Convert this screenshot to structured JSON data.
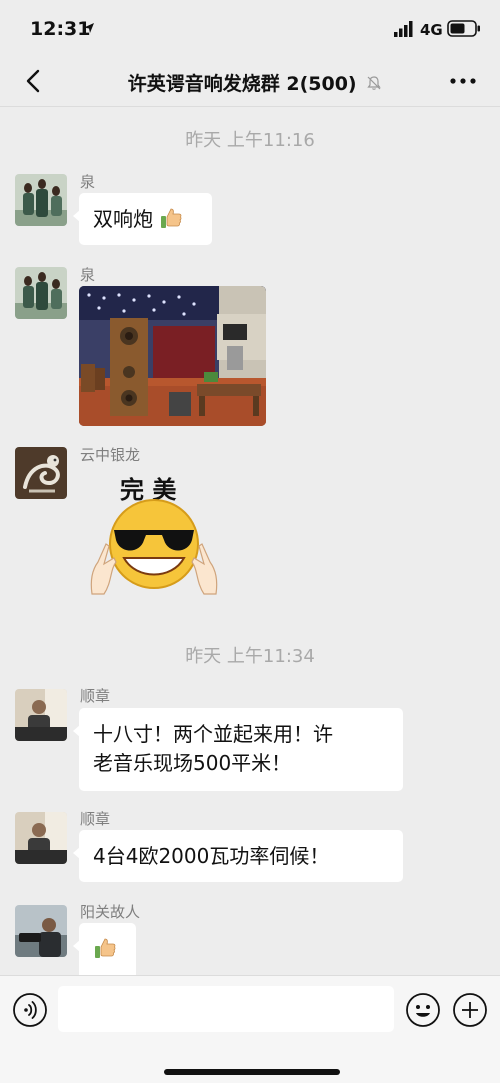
{
  "status_bar": {
    "time": "12:31",
    "network": "4G"
  },
  "header": {
    "title": "许英谔音响发烧群 2(500)"
  },
  "timestamps": [
    "昨天 上午11:16",
    "昨天 上午11:34"
  ],
  "messages": [
    {
      "sender": "泉",
      "text": "双响炮"
    },
    {
      "sender": "泉"
    },
    {
      "sender": "云中银龙",
      "sticker_caption": "完 美"
    },
    {
      "sender": "顺章",
      "line1": "十八寸！两个並起来用！许",
      "line2": "老音乐现场500平米！"
    },
    {
      "sender": "顺章",
      "text": "4台4欧2000瓦功率伺候！"
    },
    {
      "sender": "阳关故人"
    }
  ],
  "icons": [
    "back-arrow-icon",
    "mute-bell-icon",
    "more-icon",
    "thumbs-up-icon",
    "voice-icon",
    "emoji-icon",
    "plus-icon",
    "signal-icon",
    "battery-icon",
    "location-arrow-icon"
  ]
}
